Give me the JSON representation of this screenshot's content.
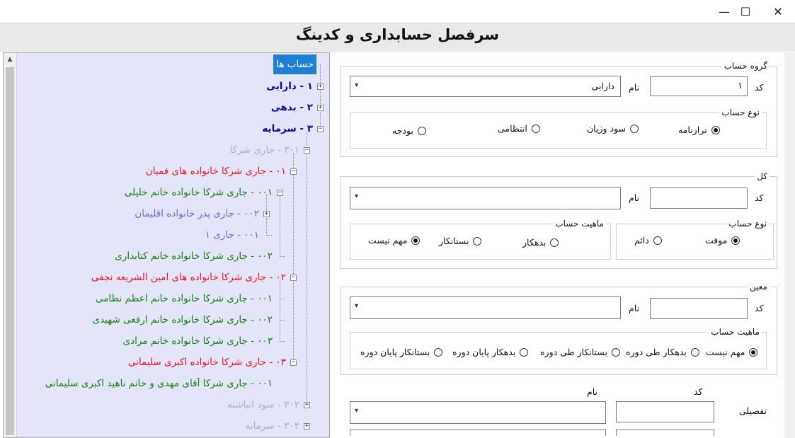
{
  "window": {
    "title": "سرفصل حسابداری و کدینگ",
    "minimize_glyph": "—",
    "maximize_glyph": "☐",
    "close_glyph": "✕"
  },
  "tree": {
    "nodes": [
      {
        "label": "حساب ها"
      },
      {
        "label": "۱ - دارایی"
      },
      {
        "label": "۲ - بدهی"
      },
      {
        "label": "۳ - سرمایه"
      },
      {
        "label": "۳۰۱ - جاری شرکا"
      },
      {
        "label": "۰۱ - جاری شرکا خانواده های قمیان"
      },
      {
        "label": "۰۰۱ - جاری شرکا خانواده خانم خلیلی"
      },
      {
        "label": "۰۰۲ - جاری پدر خانواده اقلیمان"
      },
      {
        "label": "۰۰۱ - جاری ۱"
      },
      {
        "label": "۰۰۲ - جاری شرکا خانواده خانم کتابداری"
      },
      {
        "label": "۰۲ - جاری شرکا خانواده های امین الشریعه نجفی"
      },
      {
        "label": "۰۰۱ - جاری شرکا خانواده خانم اعظم نظامی"
      },
      {
        "label": "۰۰۲ - جاری شرکا خانواده خانم ارفعی شهیدی"
      },
      {
        "label": "۰۰۳ - جاری شرکا خانواده خانم مرادی"
      },
      {
        "label": "۰۳ - جاری شرکا خانواده اکبری سلیمانی"
      },
      {
        "label": "۰۰۱ - جاری شرکا آقای مهدی و خانم ناهید اکبری سلیمانی"
      },
      {
        "label": "۳۰۲ - سود انباشته"
      },
      {
        "label": "۳۰۳ - سرمایه"
      }
    ]
  },
  "group_section": {
    "legend": "گروه حساب",
    "code_label": "کد",
    "code_value": "۱",
    "name_label": "نام",
    "name_value": "دارایی",
    "type_legend": "نوع حساب",
    "type_options": [
      "ترازنامه",
      "سود وزیان",
      "انتظامی",
      "بودجه"
    ],
    "type_selected": 0
  },
  "kol_section": {
    "legend": "کل",
    "code_label": "کد",
    "code_value": "",
    "name_label": "نام",
    "name_value": "",
    "type_legend": "نوع حساب",
    "type_options": [
      "موقت",
      "دائم"
    ],
    "type_selected": 0,
    "nature_legend": "ماهیت حساب",
    "nature_options": [
      "بدهکار",
      "بستانکار",
      "مهم نیست"
    ],
    "nature_selected": 2
  },
  "moin_section": {
    "legend": "معین",
    "code_label": "کد",
    "code_value": "",
    "name_label": "نام",
    "name_value": "",
    "nature_legend": "ماهیت حساب",
    "nature_options": [
      "مهم نیست",
      "بدهکار طی دوره",
      "بستانکار طی دوره",
      "بدهکار پایان دوره",
      "بستانکار پایان دوره"
    ],
    "nature_selected": 0
  },
  "tafsili_section": {
    "label": "تفصیلی",
    "code_header": "کد",
    "name_header": "نام",
    "code_value": "",
    "name_value": ""
  }
}
